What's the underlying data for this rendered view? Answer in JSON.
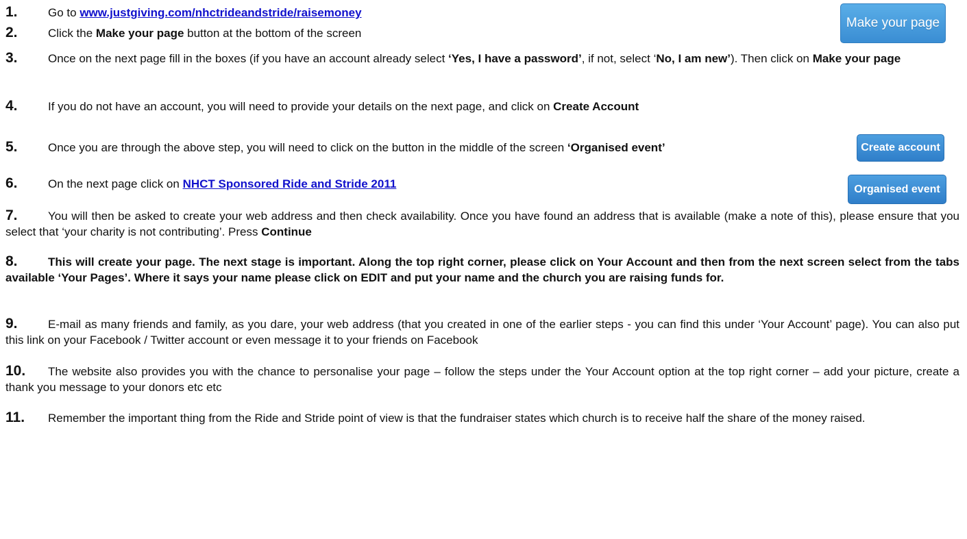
{
  "steps": [
    {
      "num": "1.",
      "pre": "Go to ",
      "link": "www.justgiving.com/nhctrideandstride/raisemoney"
    },
    {
      "num": "2.",
      "pre": "Click the ",
      "bold": "Make your page",
      "post": " button at the bottom of the screen"
    },
    {
      "num": "3.",
      "pre": "Once on the next page fill in the boxes (if you have an account already select ",
      "bold1": "‘Yes, I have a password’",
      "mid": ", if not, select ‘",
      "bold2": "No, I am new’",
      "post": "). Then click on ",
      "bold3": "Make your page"
    },
    {
      "num": "4.",
      "pre": "If you do not have an account, you will need to provide your details on the next page, and click on ",
      "bold": "Create Account"
    },
    {
      "num": "5.",
      "pre": "Once you are through the above step, you will need to click on the button in the middle of the screen ",
      "bold": "‘Organised event’"
    },
    {
      "num": "6.",
      "pre": "On the next page click on ",
      "link": "NHCT Sponsored Ride and Stride 2011"
    },
    {
      "num": "7.",
      "pre": "You will then be asked to create your web address and then check availability. Once you have found an address that is available (make a note of this), please ensure that you select that ‘your charity is not contributing’. Press ",
      "bold": "Continue"
    },
    {
      "num": "8.",
      "bold": "This will create your page. The next stage is important. Along the top right corner, please click on Your Account and then from the next screen select from the tabs available ‘Your Pages’. Where it says your name please click on EDIT and put your name and the church you are raising funds for."
    },
    {
      "num": "9.",
      "text": "E-mail as many friends and family, as you dare, your web address (that you created in one of the earlier steps - you can find this under ‘Your Account’ page). You can also put this link on your Facebook / Twitter account or even message it to your friends on Facebook"
    },
    {
      "num": "10.",
      "text": "The website also provides you with the chance to personalise your page – follow the steps under the Your Account option at the top right corner – add your picture, create a thank you message to your donors etc etc"
    },
    {
      "num": "11.",
      "text": "Remember the important thing from the Ride and Stride point of view is that the fundraiser states which church is to receive half the share of the money raised."
    }
  ],
  "buttons": {
    "make_page": "Make your page",
    "create_account": "Create account",
    "organised_event": "Organised event"
  }
}
